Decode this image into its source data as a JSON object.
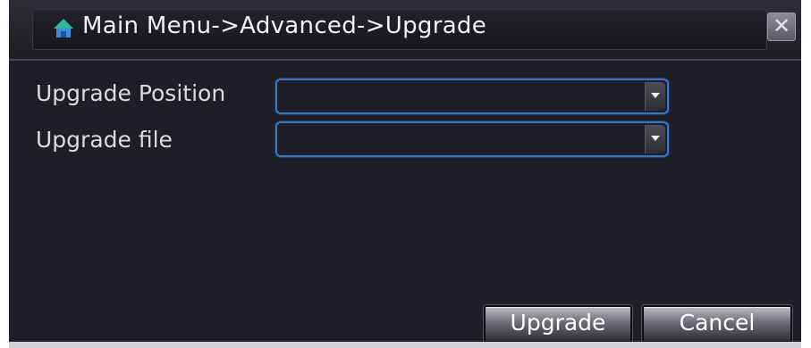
{
  "window": {
    "title": "Main Menu->Advanced->Upgrade",
    "close_label": "✕"
  },
  "fields": [
    {
      "label": "Upgrade Position",
      "value": ""
    },
    {
      "label": "Upgrade file",
      "value": ""
    }
  ],
  "buttons": {
    "upgrade": "Upgrade",
    "cancel": "Cancel"
  },
  "icons": {
    "title_icon": "home-icon",
    "dropdown_icon": "chevron-down-icon",
    "close_icon": "close-icon"
  },
  "colors": {
    "background": "#1e1e26",
    "dropdown_border": "#3d74b8",
    "text": "#dcdcdc"
  }
}
